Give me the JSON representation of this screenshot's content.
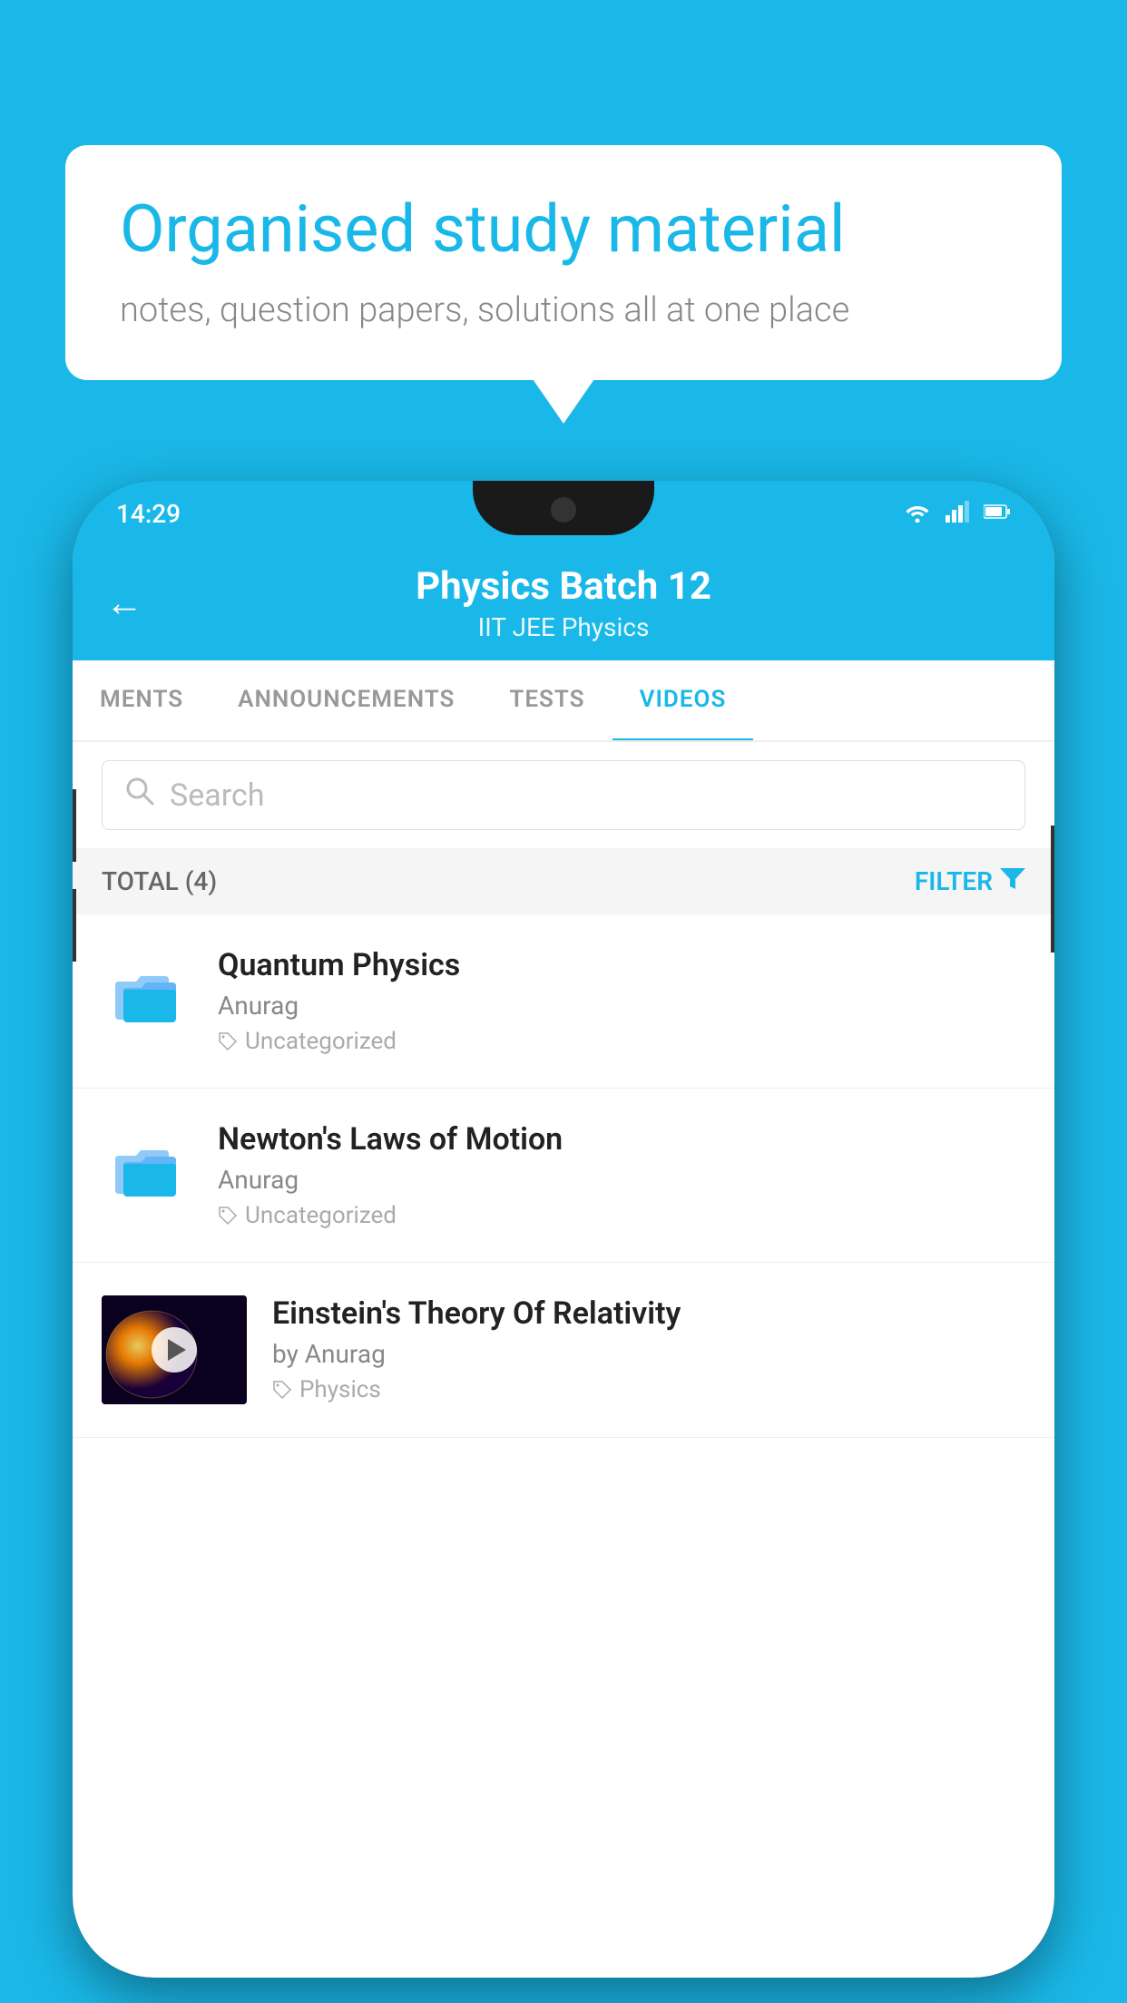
{
  "background_color": "#1ab8e8",
  "speech_bubble": {
    "title": "Organised study material",
    "subtitle": "notes, question papers, solutions all at one place"
  },
  "phone": {
    "status_bar": {
      "time": "14:29",
      "wifi": "▾",
      "signal": "▲",
      "battery": "▮"
    },
    "header": {
      "back_label": "←",
      "title": "Physics Batch 12",
      "subtitle": "IIT JEE   Physics"
    },
    "tabs": [
      {
        "label": "MENTS",
        "active": false
      },
      {
        "label": "ANNOUNCEMENTS",
        "active": false
      },
      {
        "label": "TESTS",
        "active": false
      },
      {
        "label": "VIDEOS",
        "active": true
      }
    ],
    "search": {
      "placeholder": "Search"
    },
    "filter_bar": {
      "total_label": "TOTAL (4)",
      "filter_label": "FILTER"
    },
    "videos": [
      {
        "title": "Quantum Physics",
        "author": "Anurag",
        "tag": "Uncategorized",
        "type": "folder",
        "has_thumbnail": false
      },
      {
        "title": "Newton's Laws of Motion",
        "author": "Anurag",
        "tag": "Uncategorized",
        "type": "folder",
        "has_thumbnail": false
      },
      {
        "title": "Einstein's Theory Of Relativity",
        "author": "by Anurag",
        "tag": "Physics",
        "type": "video",
        "has_thumbnail": true
      }
    ]
  }
}
